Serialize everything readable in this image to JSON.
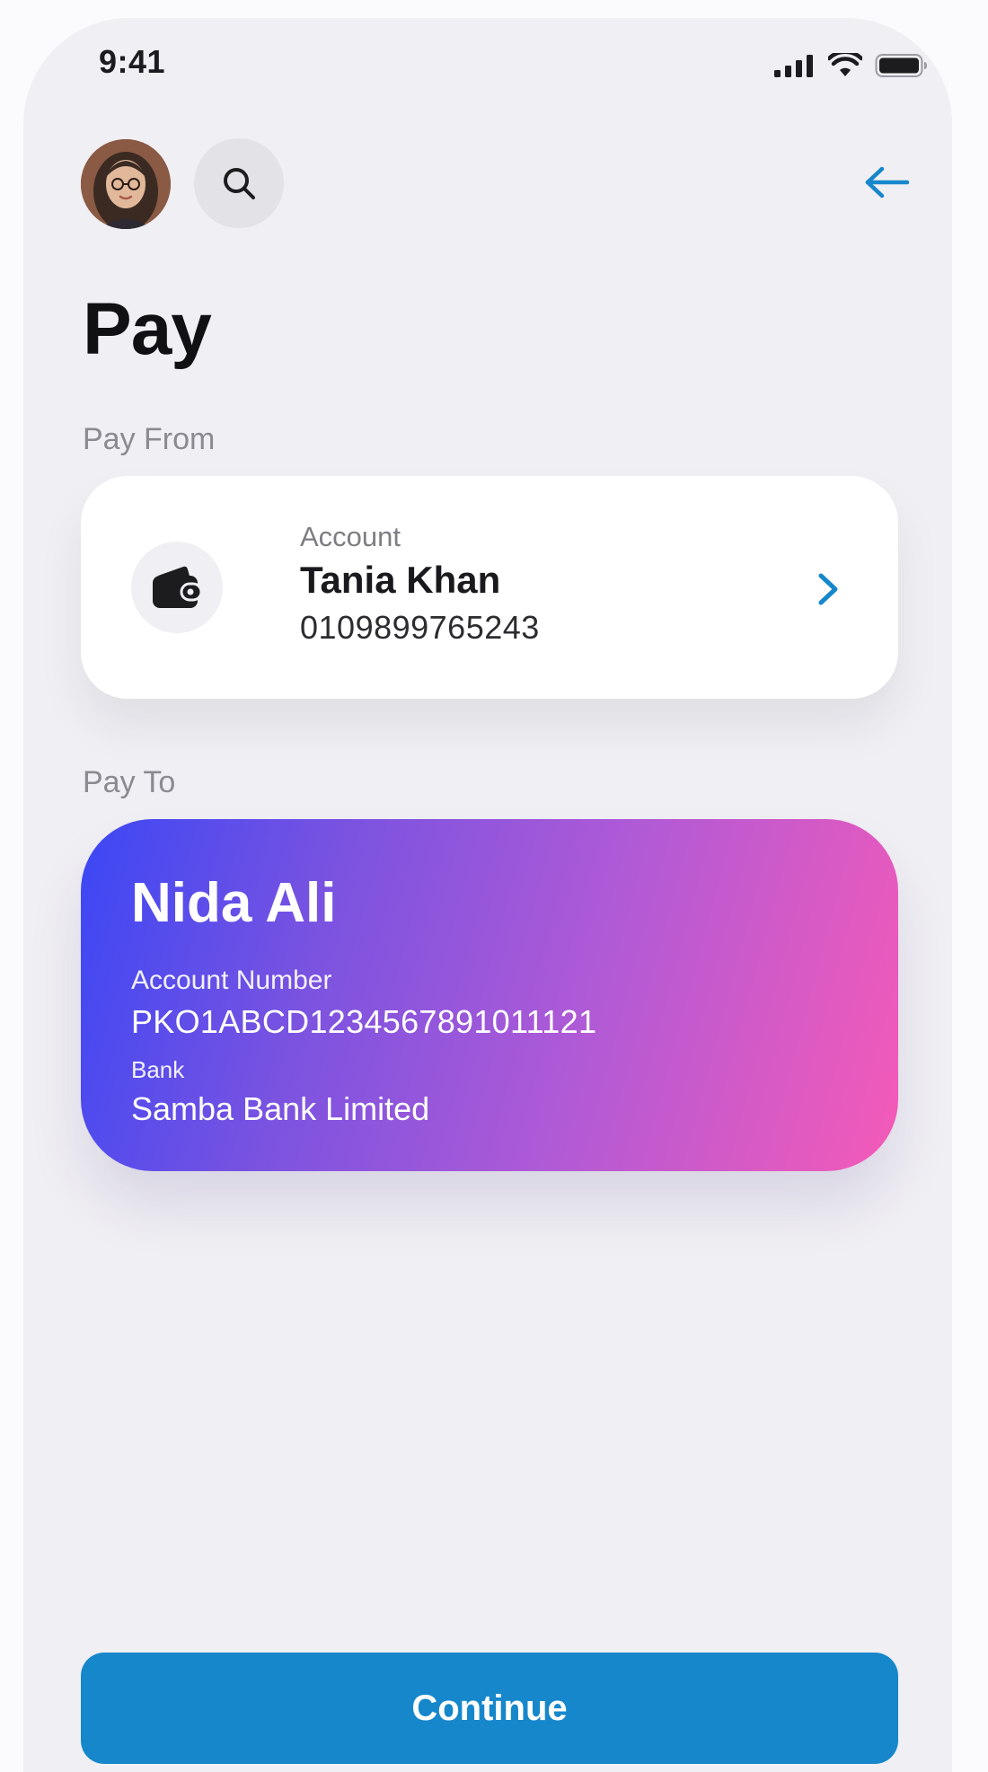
{
  "status_bar": {
    "time": "9:41"
  },
  "header": {
    "avatar_icon": "user-avatar",
    "search_icon": "search-icon",
    "back_icon": "arrow-left-icon"
  },
  "page": {
    "title": "Pay"
  },
  "pay_from": {
    "section_label": "Pay From",
    "account_label": "Account",
    "name": "Tania Khan",
    "number": "0109899765243",
    "icon": "wallet-icon"
  },
  "pay_to": {
    "section_label": "Pay To",
    "name": "Nida Ali",
    "account_number_label": "Account Number",
    "account_number": "PKO1ABCD1234567891011121",
    "bank_label": "Bank",
    "bank_name": "Samba Bank Limited"
  },
  "footer": {
    "continue_label": "Continue"
  },
  "colors": {
    "accent": "#1687cb",
    "screen_bg": "#f0eff3",
    "gradient_start": "#3b47f5",
    "gradient_end": "#f55ab7"
  }
}
